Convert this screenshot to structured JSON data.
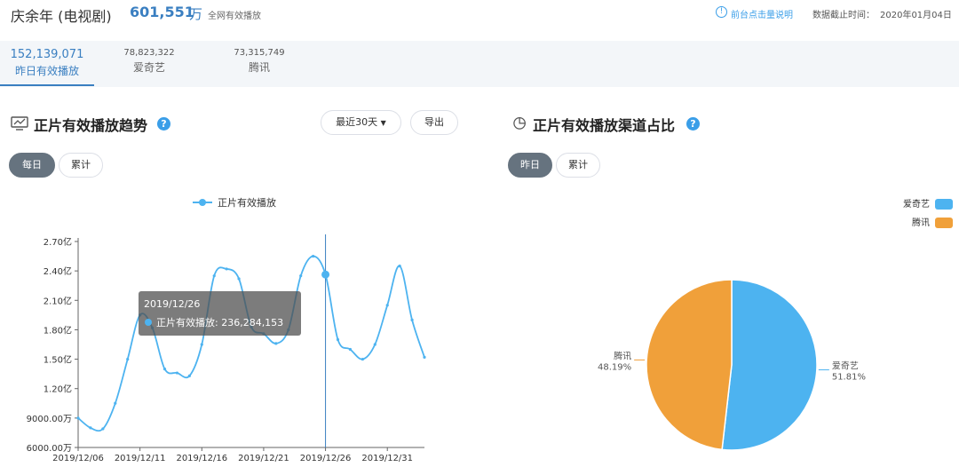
{
  "header": {
    "show_title": "庆余年 (电视剧)",
    "total_value": "601,551",
    "total_unit": "万",
    "total_label": "全网有效播放",
    "info_link": "前台点击量说明",
    "cutoff_label": "数据截止时间：",
    "cutoff_date": "2020年01月04日"
  },
  "platform_tabs": [
    {
      "value": "152,139,071",
      "label": "昨日有效播放"
    },
    {
      "value": "78,823,322",
      "label": "爱奇艺"
    },
    {
      "value": "73,315,749",
      "label": "腾讯"
    }
  ],
  "trend": {
    "title": "正片有效播放趋势",
    "range_select": "最近30天",
    "export_button": "导出",
    "mode_daily": "每日",
    "mode_cumulative": "累计"
  },
  "share": {
    "title": "正片有效播放渠道占比",
    "mode_yesterday": "昨日",
    "mode_cumulative": "累计"
  },
  "colors": {
    "accent": "#3a7fc1",
    "line": "#4db3f0",
    "iqiyi": "#4db3f0",
    "tencent": "#f0a03a"
  },
  "chart_data": [
    {
      "type": "line",
      "legend": [
        "正片有效播放"
      ],
      "y_tick_labels": [
        "6000.00万",
        "9000.00万",
        "1.20亿",
        "1.50亿",
        "1.80亿",
        "2.10亿",
        "2.40亿",
        "2.70亿"
      ],
      "x_tick_labels": [
        "2019/12/06",
        "2019/12/11",
        "2019/12/16",
        "2019/12/21",
        "2019/12/26",
        "2019/12/31"
      ],
      "ylim": [
        60000000,
        270000000
      ],
      "x": [
        "2019/12/06",
        "2019/12/07",
        "2019/12/08",
        "2019/12/09",
        "2019/12/10",
        "2019/12/11",
        "2019/12/12",
        "2019/12/13",
        "2019/12/14",
        "2019/12/15",
        "2019/12/16",
        "2019/12/17",
        "2019/12/18",
        "2019/12/19",
        "2019/12/20",
        "2019/12/21",
        "2019/12/22",
        "2019/12/23",
        "2019/12/24",
        "2019/12/25",
        "2019/12/26",
        "2019/12/27",
        "2019/12/28",
        "2019/12/29",
        "2019/12/30",
        "2019/12/31",
        "2020/01/01",
        "2020/01/02",
        "2020/01/03"
      ],
      "series": [
        {
          "name": "正片有效播放",
          "values": [
            90000000,
            80000000,
            79000000,
            105000000,
            150000000,
            195000000,
            182000000,
            140000000,
            136000000,
            133000000,
            165000000,
            235000000,
            242000000,
            232000000,
            183000000,
            176000000,
            166000000,
            180000000,
            235000000,
            255000000,
            236284153,
            170000000,
            160000000,
            150000000,
            165000000,
            205000000,
            245000000,
            190000000,
            152000000
          ]
        }
      ],
      "tooltip": {
        "date": "2019/12/26",
        "label": "正片有效播放: 236,284,153"
      }
    },
    {
      "type": "pie",
      "legend": [
        "爱奇艺",
        "腾讯"
      ],
      "slices": [
        {
          "name": "爱奇艺",
          "percent_label": "51.81%",
          "value": 51.81,
          "color": "#4db3f0"
        },
        {
          "name": "腾讯",
          "percent_label": "48.19%",
          "value": 48.19,
          "color": "#f0a03a"
        }
      ]
    }
  ]
}
